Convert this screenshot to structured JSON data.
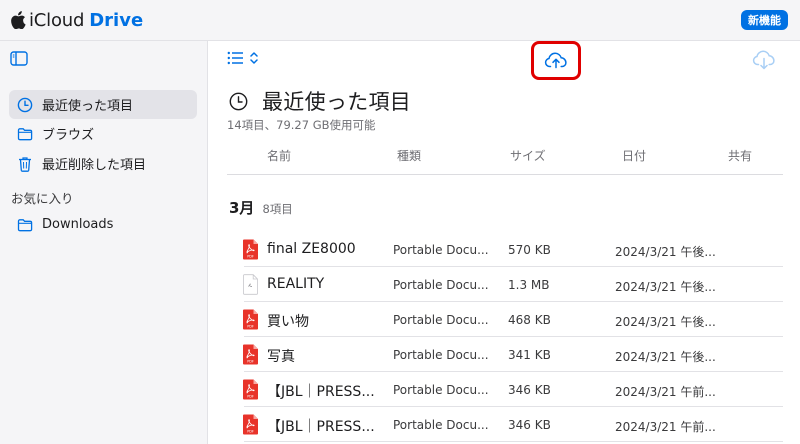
{
  "header": {
    "brand_icloud": "iCloud",
    "brand_drive": "Drive",
    "new_features_label": "新機能"
  },
  "sidebar": {
    "items": [
      {
        "label": "最近使った項目",
        "icon": "clock-icon",
        "active": true
      },
      {
        "label": "ブラウズ",
        "icon": "folder-icon"
      },
      {
        "label": "最近削除した項目",
        "icon": "trash-icon"
      }
    ],
    "favorites_heading": "お気に入り",
    "favorites": [
      {
        "label": "Downloads",
        "icon": "folder-icon"
      }
    ]
  },
  "main": {
    "title": "最近使った項目",
    "subtitle": "14項目、79.27 GB使用可能",
    "columns": {
      "name": "名前",
      "kind": "種類",
      "size": "サイズ",
      "date": "日付",
      "shared": "共有"
    },
    "group": {
      "month": "3月",
      "count": "8項目"
    },
    "files": [
      {
        "name": "final ZE8000",
        "kind": "Portable Docu...",
        "size": "570 KB",
        "date": "2024/3/21 午後...",
        "icon": "pdf-icon"
      },
      {
        "name": "REALITY",
        "kind": "Portable Docu...",
        "size": "1.3 MB",
        "date": "2024/3/21 午後...",
        "icon": "document-icon"
      },
      {
        "name": "買い物",
        "kind": "Portable Docu...",
        "size": "468 KB",
        "date": "2024/3/21 午後...",
        "icon": "pdf-icon"
      },
      {
        "name": "写真",
        "kind": "Portable Docu...",
        "size": "341 KB",
        "date": "2024/3/21 午後...",
        "icon": "pdf-icon"
      },
      {
        "name": "【JBL｜PRESS...",
        "kind": "Portable Docu...",
        "size": "346 KB",
        "date": "2024/3/21 午前...",
        "icon": "pdf-icon"
      },
      {
        "name": "【JBL｜PRESS...",
        "kind": "Portable Docu...",
        "size": "346 KB",
        "date": "2024/3/21 午前...",
        "icon": "pdf-icon"
      }
    ]
  },
  "colors": {
    "accent": "#0071e3",
    "highlight": "#e00000",
    "pdf": "#e8332a"
  }
}
